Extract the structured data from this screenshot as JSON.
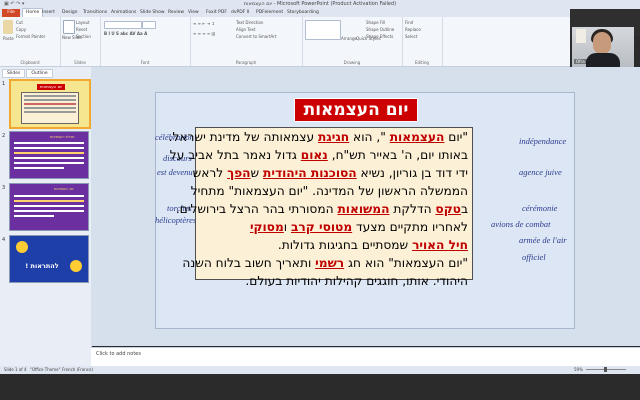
{
  "window": {
    "title": "יום העצמאות - Microsoft PowerPoint (Product Activation Failed)"
  },
  "ribbon": {
    "file_tab": "File",
    "tabs": [
      "Home",
      "Insert",
      "Design",
      "Transitions",
      "Animations",
      "Slide Show",
      "Review",
      "View",
      "Foxit PDF",
      "dvPDF II",
      "PDFelement",
      "Storyboarding"
    ],
    "groups": {
      "clipboard": "Clipboard",
      "slides": "Slides",
      "font": "Font",
      "paragraph": "Paragraph",
      "drawing": "Drawing",
      "editing": "Editing"
    },
    "buttons": {
      "paste": "Paste",
      "cut": "Cut",
      "copy": "Copy",
      "format_painter": "Format Painter",
      "new_slide": "New Slide",
      "layout": "Layout",
      "reset": "Reset",
      "section": "Section",
      "text_direction": "Text Direction",
      "align_text": "Align Text",
      "convert_smartart": "Convert to SmartArt",
      "arrange": "Arrange",
      "quick_styles": "Quick Styles",
      "shape_fill": "Shape Fill",
      "shape_outline": "Shape Outline",
      "shape_effects": "Shape Effects",
      "find": "Find",
      "replace": "Replace",
      "select": "Select"
    }
  },
  "webcam": {
    "name": "Ofra"
  },
  "pane": {
    "tabs": [
      "Slides",
      "Outline"
    ],
    "thumbnails": [
      {
        "num": "1",
        "title": "יום העצמאות"
      },
      {
        "num": "2",
        "caption": "מגילת העצמאות"
      },
      {
        "num": "3",
        "caption": "יום העצמאות"
      },
      {
        "num": "4",
        "caption": "להתראות !"
      }
    ]
  },
  "slide": {
    "title": "יום העצמאות",
    "french_left": [
      "célébration",
      "discours",
      "est devenu",
      "torches",
      "hélicoptères"
    ],
    "french_right": [
      "indépendance",
      "agence juive",
      "cérémonie",
      "avions de combat",
      "armée de l'air",
      "officiel"
    ]
  },
  "notes": {
    "placeholder": "Click to add notes"
  },
  "status": {
    "slide": "Slide 1 of 4",
    "theme": "\"Office Theme\"",
    "language": "French (France)",
    "zoom": "59%"
  }
}
